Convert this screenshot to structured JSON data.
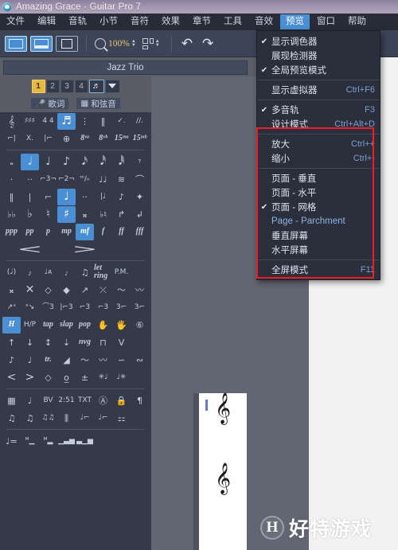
{
  "window": {
    "title": "Amazing Grace - Guitar Pro 7",
    "app_icon": "guitar-pro-logo-icon"
  },
  "menubar": {
    "items": [
      {
        "label": "文件",
        "active": false
      },
      {
        "label": "编辑",
        "active": false
      },
      {
        "label": "音轨",
        "active": false
      },
      {
        "label": "小节",
        "active": false
      },
      {
        "label": "音符",
        "active": false
      },
      {
        "label": "效果",
        "active": false
      },
      {
        "label": "章节",
        "active": false
      },
      {
        "label": "工具",
        "active": false
      },
      {
        "label": "音效",
        "active": false
      },
      {
        "label": "预览",
        "active": true
      },
      {
        "label": "窗口",
        "active": false
      },
      {
        "label": "帮助",
        "active": false
      }
    ]
  },
  "toolbar": {
    "view_buttons": [
      {
        "name": "view-page-mode",
        "selected": true
      },
      {
        "name": "view-screen-mode",
        "selected": true
      },
      {
        "name": "view-single-mode",
        "selected": false
      }
    ],
    "zoom_icon": "magnifier-icon",
    "zoom_value": "100%",
    "zoom_stepper_up": "▲",
    "zoom_stepper_down": "▼",
    "layout_icon": "grid-layout-icon",
    "undo_label": "↶",
    "redo_label": "↷"
  },
  "track": {
    "name": "Jazz Trio",
    "numbers": [
      "1",
      "2",
      "3",
      "4"
    ],
    "selected_number": "1",
    "note_button_icon": "beamed-notes-icon",
    "dropdown_icon": "triangle-down-icon",
    "lyrics_button": {
      "icon": "microphone-icon",
      "label": "歌词"
    },
    "chord_button": {
      "icon": "chord-grid-icon",
      "label": "和弦音"
    }
  },
  "palette": {
    "rows": [
      {
        "cells": [
          {
            "g": "𝄞",
            "k": "ser"
          },
          {
            "g": "♯♯♯",
            "k": "xs"
          },
          {
            "g": "4\n4",
            "k": "xs"
          },
          {
            "g": "♬",
            "k": "sel"
          },
          {
            "g": "⋮",
            "k": "sm"
          },
          {
            "g": "‖",
            "k": "sm"
          },
          {
            "g": "✓.",
            "k": "xs"
          },
          {
            "g": "//.",
            "k": "xs"
          }
        ]
      },
      {
        "cells": [
          {
            "g": "⌐|",
            "k": "xs"
          },
          {
            "g": "X.",
            "k": "xs"
          },
          {
            "g": "|⌐",
            "k": "xs"
          },
          {
            "g": "⊕",
            "k": "sm"
          },
          {
            "g": "8ᵛᵃ",
            "k": "it"
          },
          {
            "g": "8ᵛᵇ",
            "k": "it"
          },
          {
            "g": "15ᵐᵃ",
            "k": "it"
          },
          {
            "g": "15ᵐᵇ",
            "k": "it"
          }
        ]
      },
      {
        "divider": true
      },
      {
        "cells": [
          {
            "g": "𝅝",
            "k": "sm"
          },
          {
            "g": "𝅗𝅥",
            "k": "sel"
          },
          {
            "g": "♩",
            "k": ""
          },
          {
            "g": "♪",
            "k": ""
          },
          {
            "g": "𝅘𝅥𝅯",
            "k": ""
          },
          {
            "g": "𝅘𝅥𝅰",
            "k": ""
          },
          {
            "g": "𝅘𝅥𝅱",
            "k": ""
          },
          {
            "g": "𝄾",
            "k": ""
          }
        ]
      },
      {
        "cells": [
          {
            "g": "·",
            "k": "sm"
          },
          {
            "g": "··",
            "k": "sm"
          },
          {
            "g": "⌐3¬",
            "k": "xs"
          },
          {
            "g": "⌐2¬",
            "k": "xs"
          },
          {
            "g": "ᵐ/ₙ",
            "k": "xs"
          },
          {
            "g": "♩♩",
            "k": "sm"
          },
          {
            "g": "≋",
            "k": "sm"
          },
          {
            "g": "⌒",
            "k": "sm"
          }
        ]
      },
      {
        "cells": [
          {
            "g": "‖",
            "k": "sm"
          },
          {
            "g": "|",
            "k": "sm"
          },
          {
            "g": "⌐",
            "k": "sm"
          },
          {
            "g": "♩",
            "k": "sel"
          },
          {
            "g": "··",
            "k": "sm"
          },
          {
            "g": "|♩",
            "k": "xs"
          },
          {
            "g": "♪",
            "k": "sm"
          },
          {
            "g": "✦",
            "k": "sm"
          }
        ]
      },
      {
        "cells": [
          {
            "g": "♭♭",
            "k": "sm"
          },
          {
            "g": "♭",
            "k": ""
          },
          {
            "g": "♮",
            "k": ""
          },
          {
            "g": "♯",
            "k": "sel"
          },
          {
            "g": "𝄪",
            "k": "sm"
          },
          {
            "g": "♭♮",
            "k": "sm"
          },
          {
            "g": "↱",
            "k": "sm"
          },
          {
            "g": "↲",
            "k": "sm"
          }
        ]
      },
      {
        "cells": [
          {
            "g": "ppp",
            "k": "it"
          },
          {
            "g": "pp",
            "k": "it"
          },
          {
            "g": "p",
            "k": "it"
          },
          {
            "g": "mp",
            "k": "it"
          },
          {
            "g": "mf",
            "k": "it sel"
          },
          {
            "g": "f",
            "k": "it"
          },
          {
            "g": "ff",
            "k": "it"
          },
          {
            "g": "fff",
            "k": "it"
          }
        ]
      },
      {
        "cells": [
          {
            "g": "",
            "k": ""
          },
          {
            "g": "<",
            "k": "wide-cres"
          },
          {
            "g": "",
            "k": ""
          },
          {
            "g": "",
            "k": ""
          },
          {
            "g": ">",
            "k": "wide-dim"
          },
          {
            "g": "",
            "k": ""
          },
          {
            "g": "",
            "k": ""
          },
          {
            "g": "",
            "k": ""
          }
        ]
      },
      {
        "divider": true
      },
      {
        "cells": [
          {
            "g": "(♩)",
            "k": "xs"
          },
          {
            "g": "𝆔",
            "k": "sm"
          },
          {
            "g": "♩ᴀ",
            "k": "xs"
          },
          {
            "g": "𝆕",
            "k": "sm"
          },
          {
            "g": "♫",
            "k": "sm"
          },
          {
            "g": "let ring",
            "k": "xs it"
          },
          {
            "g": "P.M.",
            "k": "xs"
          },
          {
            "g": "",
            "k": ""
          }
        ]
      },
      {
        "cells": [
          {
            "g": "𝄪",
            "k": "sm"
          },
          {
            "g": "✕",
            "k": ""
          },
          {
            "g": "◇",
            "k": "sm"
          },
          {
            "g": "◆",
            "k": "sm"
          },
          {
            "g": "↗",
            "k": "sm"
          },
          {
            "g": "⤫",
            "k": "sm"
          },
          {
            "g": "〜",
            "k": "sm"
          },
          {
            "g": "〰",
            "k": "sm"
          }
        ]
      },
      {
        "cells": [
          {
            "g": "↗ˣ",
            "k": "xs"
          },
          {
            "g": "ˣ↘",
            "k": "xs"
          },
          {
            "g": "⌒3",
            "k": "xs"
          },
          {
            "g": "|⌐3",
            "k": "xs"
          },
          {
            "g": "⌐3",
            "k": "xs"
          },
          {
            "g": "⌐3",
            "k": "xs"
          },
          {
            "g": "3⌐",
            "k": "xs"
          },
          {
            "g": "3⌐",
            "k": "xs"
          }
        ]
      },
      {
        "cells": [
          {
            "g": "H",
            "k": "it sel"
          },
          {
            "g": "H/P",
            "k": "xs"
          },
          {
            "g": "tap",
            "k": "it"
          },
          {
            "g": "slap",
            "k": "it"
          },
          {
            "g": "pop",
            "k": "it"
          },
          {
            "g": "✋",
            "k": "sm"
          },
          {
            "g": "🖐",
            "k": "sm"
          },
          {
            "g": "⑥",
            "k": "sm"
          }
        ]
      },
      {
        "cells": [
          {
            "g": "↑",
            "k": "sm"
          },
          {
            "g": "↓",
            "k": "sm"
          },
          {
            "g": "↕",
            "k": "sm"
          },
          {
            "g": "⇣",
            "k": "sm"
          },
          {
            "g": "nvg",
            "k": "it"
          },
          {
            "g": "⊓",
            "k": "sm"
          },
          {
            "g": "V",
            "k": "sm"
          },
          {
            "g": "",
            "k": ""
          }
        ]
      },
      {
        "cells": [
          {
            "g": "♪",
            "k": "sm"
          },
          {
            "g": "♩",
            "k": "sm"
          },
          {
            "g": "tr.",
            "k": "xs it"
          },
          {
            "g": "◢",
            "k": "sm"
          },
          {
            "g": "〜",
            "k": "sm"
          },
          {
            "g": "〰",
            "k": "sm"
          },
          {
            "g": "∽",
            "k": "sm"
          },
          {
            "g": "∾",
            "k": "sm"
          }
        ]
      },
      {
        "cells": [
          {
            "g": "<",
            "k": ""
          },
          {
            "g": ">",
            "k": ""
          },
          {
            "g": "◇",
            "k": "sm"
          },
          {
            "g": "ᴏ̲",
            "k": "sm"
          },
          {
            "g": "±",
            "k": "sm"
          },
          {
            "g": "✳♩",
            "k": "xs"
          },
          {
            "g": "♩✳",
            "k": "xs"
          },
          {
            "g": "",
            "k": ""
          }
        ]
      },
      {
        "divider": true
      },
      {
        "cells": [
          {
            "g": "▦",
            "k": "sm"
          },
          {
            "g": "♩",
            "k": "sm"
          },
          {
            "g": "BV",
            "k": "xs"
          },
          {
            "g": "2:51",
            "k": "xs"
          },
          {
            "g": "TXT",
            "k": "xs"
          },
          {
            "g": "Ⓐ",
            "k": "sm"
          },
          {
            "g": "🔒",
            "k": "sm"
          },
          {
            "g": "¶",
            "k": "sm"
          }
        ]
      },
      {
        "cells": [
          {
            "g": "♫",
            "k": "sm"
          },
          {
            "g": "♫",
            "k": "sm"
          },
          {
            "g": "♫♫",
            "k": "xs"
          },
          {
            "g": "⫼",
            "k": "sm"
          },
          {
            "g": "♩⌐",
            "k": "xs"
          },
          {
            "g": "♩⌐",
            "k": "xs"
          },
          {
            "g": "⚏",
            "k": "sm"
          },
          {
            "g": "",
            "k": ""
          }
        ]
      },
      {
        "divider": true
      },
      {
        "cells": [
          {
            "g": "♩=",
            "k": "sm"
          },
          {
            "g": "ᴹ▁",
            "k": "xs"
          },
          {
            "g": "ᴹ▂",
            "k": "xs"
          },
          {
            "g": "▁▃▅",
            "k": "xs"
          },
          {
            "g": "▃▁▅",
            "k": "xs"
          },
          {
            "g": "",
            "k": ""
          },
          {
            "g": "",
            "k": ""
          },
          {
            "g": "",
            "k": ""
          }
        ]
      }
    ]
  },
  "dropdown": {
    "name": "preview-menu",
    "groups": [
      {
        "items": [
          {
            "label": "显示调色器",
            "shortcut": "",
            "checked": true,
            "blue": false
          },
          {
            "label": "展现检测器",
            "shortcut": "",
            "checked": false,
            "blue": false
          },
          {
            "label": "全局预览模式",
            "shortcut": "",
            "checked": true,
            "blue": false
          }
        ]
      },
      {
        "items": [
          {
            "label": "显示虚拟器",
            "shortcut": "Ctrl+F6",
            "checked": false,
            "blue": false
          }
        ]
      },
      {
        "items": [
          {
            "label": "多音轨",
            "shortcut": "F3",
            "checked": true,
            "blue": false
          },
          {
            "label": "设计模式",
            "shortcut": "Ctrl+Alt+D",
            "checked": false,
            "blue": false
          }
        ]
      },
      {
        "items": [
          {
            "label": "放大",
            "shortcut": "Ctrl++",
            "checked": false,
            "blue": false
          },
          {
            "label": "缩小",
            "shortcut": "Ctrl+-",
            "checked": false,
            "blue": false
          }
        ]
      },
      {
        "items": [
          {
            "label": "页面 - 垂直",
            "shortcut": "",
            "checked": false,
            "blue": false
          },
          {
            "label": "页面 - 水平",
            "shortcut": "",
            "checked": false,
            "blue": false
          },
          {
            "label": "页面 - 网格",
            "shortcut": "",
            "checked": true,
            "blue": false
          },
          {
            "label": "Page - Parchment",
            "shortcut": "",
            "checked": false,
            "blue": true
          },
          {
            "label": "垂直屏幕",
            "shortcut": "",
            "checked": false,
            "blue": false
          },
          {
            "label": "水平屏幕",
            "shortcut": "",
            "checked": false,
            "blue": false
          }
        ]
      },
      {
        "items": [
          {
            "label": "全屏模式",
            "shortcut": "F11",
            "checked": false,
            "blue": false
          }
        ]
      }
    ]
  },
  "highlight": {
    "name": "red-annotation-box",
    "color": "#ee1c25"
  },
  "watermark": {
    "badge": "H",
    "text": "好特游戏",
    "text_bright": "好特游",
    "text_dim": "戏"
  },
  "score": {
    "clef_glyph": "𝄞"
  },
  "colors": {
    "titlebar": "#a095ae",
    "menubar": "#282c38",
    "toolbar": "#3d4456",
    "palette": "#343a49",
    "accent_blue": "#4a8fd4",
    "accent_gold": "#e8b93f",
    "menu_bg": "#2b2f3c",
    "shortcut_blue": "#7a9fd6",
    "highlight_red": "#ee1c25",
    "doc_bg": "#5a5d66"
  }
}
